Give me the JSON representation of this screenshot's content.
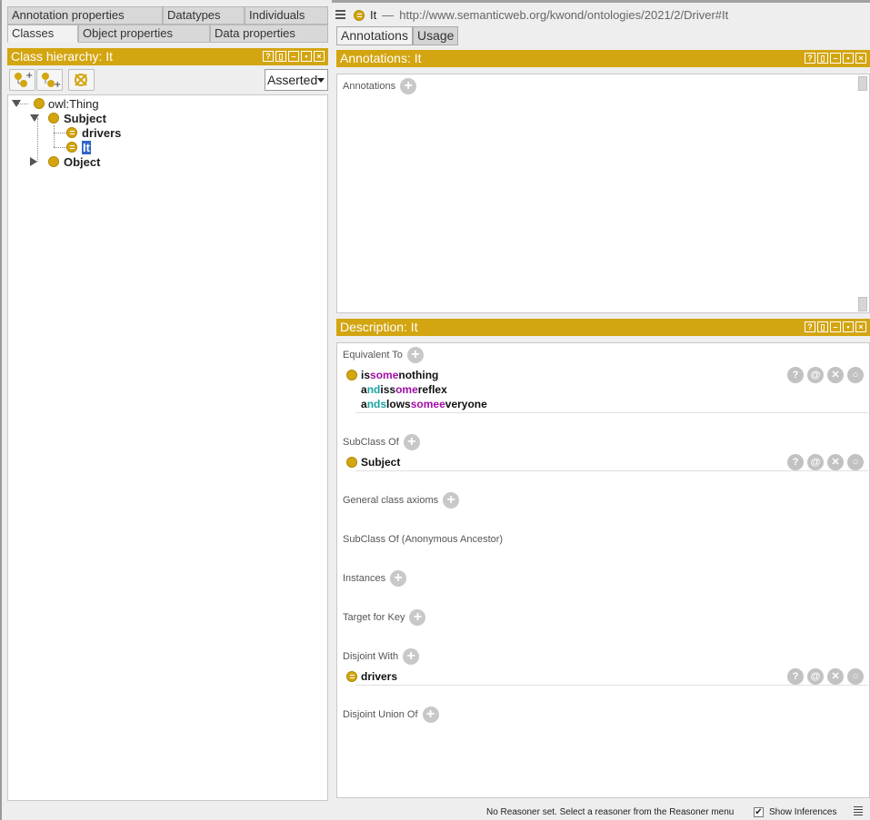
{
  "left": {
    "tabs_row1": [
      "Annotation properties",
      "Datatypes",
      "Individuals"
    ],
    "tabs_row2": [
      "Classes",
      "Object properties",
      "Data properties"
    ],
    "panel_title": "Class hierarchy: It",
    "dropdown_value": "Asserted",
    "tree": {
      "root": "owl:Thing",
      "subject": "Subject",
      "drivers": "drivers",
      "it": "It",
      "object": "Object"
    }
  },
  "right": {
    "entity_name": "It",
    "separator": "—",
    "iri": "http://www.semanticweb.org/kwond/ontologies/2021/2/Driver#It",
    "tabs": [
      "Annotations",
      "Usage"
    ],
    "annotations_title": "Annotations: It",
    "annotations_label": "Annotations",
    "description_title": "Description: It",
    "sections": {
      "equivalent_to": "Equivalent To",
      "subclass_of": "SubClass Of",
      "general_axioms": "General class axioms",
      "anon_ancestor": "SubClass Of (Anonymous Ancestor)",
      "instances": "Instances",
      "target_for_key": "Target for Key",
      "disjoint_with": "Disjoint With",
      "disjoint_union_of": "Disjoint Union Of"
    },
    "equivalent_axiom": {
      "l1": [
        "is ",
        "some",
        " nothing"
      ],
      "l2": [
        "a",
        "nd",
        " is ",
        "s",
        "ome",
        " reflex"
      ],
      "l3": [
        "a",
        "nd",
        " ",
        "s",
        "lows ",
        "some",
        " ",
        "e",
        "veryone"
      ]
    },
    "subclass_value": "Subject",
    "disjoint_value": "drivers"
  },
  "status": {
    "message": "No Reasoner set. Select a reasoner from the Reasoner menu",
    "show_inferences_label": "Show Inferences",
    "show_inferences_checked": "✔"
  },
  "colors": {
    "gold": "#d3a510",
    "keyword_purple": "#a30ea8",
    "keyword_teal": "#1aa3a3"
  }
}
